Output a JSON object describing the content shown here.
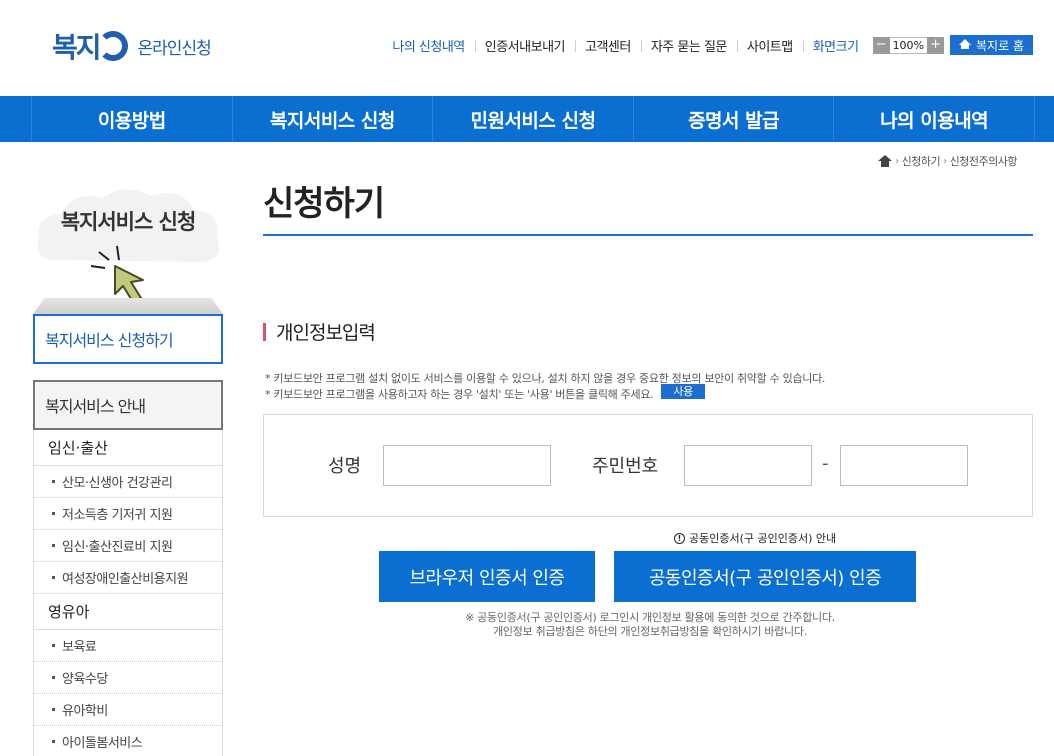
{
  "header": {
    "logo_mark": "복지",
    "logo_text": "온라인신청",
    "links": [
      {
        "label": "나의 신청내역",
        "style": "blue"
      },
      {
        "label": "인증서내보내기",
        "style": "normal"
      },
      {
        "label": "고객센터",
        "style": "normal"
      },
      {
        "label": "자주 묻는 질문",
        "style": "normal"
      },
      {
        "label": "사이트맵",
        "style": "normal"
      },
      {
        "label": "화면크기",
        "style": "blue"
      }
    ],
    "zoom": {
      "minus": "−",
      "value": "100%",
      "plus": "+"
    },
    "home_button": "복지로 홈"
  },
  "nav": {
    "items": [
      "이용방법",
      "복지서비스 신청",
      "민원서비스 신청",
      "증명서 발급",
      "나의 이용내역"
    ]
  },
  "breadcrumb": {
    "items": [
      "신청하기",
      "신청전주의사항"
    ]
  },
  "sidebar": {
    "title": "복지서비스 신청",
    "apply": "복지서비스 신청하기",
    "guide": "복지서비스 안내",
    "groups": [
      {
        "category": "임신·출산",
        "items": [
          "산모·신생아 건강관리",
          "저소득층 기저귀 지원",
          "임신·출산진료비 지원",
          "여성장애인출산비용지원"
        ]
      },
      {
        "category": "영유아",
        "items": [
          "보육료",
          "양육수당",
          "유아학비",
          "아이돌봄서비스"
        ]
      }
    ]
  },
  "main": {
    "title": "신청하기",
    "section_title": "개인정보입력",
    "notice": [
      "* 키보드보안 프로그램 설치 없이도 서비스를 이용할 수 있으나, 설치 하지 않을 경우 중요한 정보의 보안이 취약할 수 있습니다.",
      "* 키보드보안 프로그램을 사용하고자 하는 경우 '설치' 또는 '사용' 버튼을 클릭해 주세요."
    ],
    "use_button": "사용",
    "form": {
      "name_label": "성명",
      "name_value": "",
      "rrn_label": "주민번호",
      "rrn_front": "",
      "rrn_dash": "-",
      "rrn_back": ""
    },
    "cert_note": "공동인증서(구 공인인증서) 안내",
    "buttons": {
      "browser": "브라우저 인증서 인증",
      "joint": "공동인증서(구 공인인증서) 인증"
    },
    "footer_notes": [
      "※ 공동인증서(구 공인인증서) 로그인시 개인정보 활용에 동의한 것으로 간주합니다.",
      "개인정보 취급방침은 하단의 개인정보취급방침을 확인하시기 바랍니다."
    ]
  },
  "colors": {
    "brand_blue": "#0a6fd1",
    "accent_pink": "#e0526a",
    "cursor_green": "#c2c97a"
  }
}
